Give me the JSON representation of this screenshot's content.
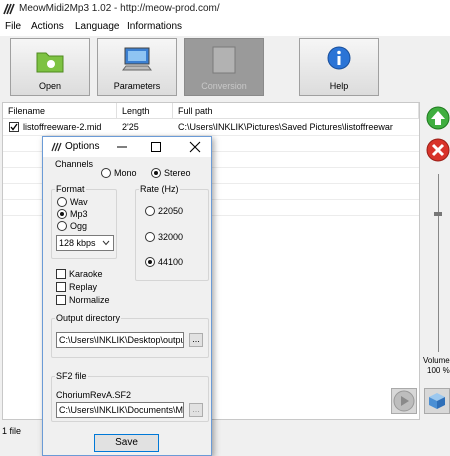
{
  "window": {
    "title": "MeowMidi2Mp3 1.02 - http://meow-prod.com/"
  },
  "menu": [
    "File",
    "Actions",
    "Language",
    "Informations"
  ],
  "toolbar": {
    "open": "Open",
    "parameters": "Parameters",
    "conversion": "Conversion",
    "help": "Help"
  },
  "filelist": {
    "columns": [
      "Filename",
      "Length",
      "Full path"
    ],
    "rows": [
      {
        "filename": "listoffreeware-2.mid",
        "length": "2'25",
        "path": "C:\\Users\\INKLIK\\Pictures\\Saved Pictures\\listoffreewar",
        "checked": true
      }
    ]
  },
  "side": {
    "volume_label": "Volume",
    "volume_value": "100 %",
    "volume_level": 1.0
  },
  "status": {
    "count": "1 file"
  },
  "dialog": {
    "title": "Options",
    "channels": {
      "label": "Channels",
      "mono": "Mono",
      "stereo": "Stereo",
      "selected": "Stereo"
    },
    "format": {
      "label": "Format",
      "wav": "Wav",
      "mp3": "Mp3",
      "ogg": "Ogg",
      "selected": "Mp3",
      "bitrate": "128 kbps"
    },
    "rate": {
      "label": "Rate (Hz)",
      "r1": "22050",
      "r2": "32000",
      "r3": "44100",
      "selected": "44100"
    },
    "options": {
      "karaoke": "Karaoke",
      "replay": "Replay",
      "normalize": "Normalize"
    },
    "output": {
      "label": "Output directory",
      "value": "C:\\Users\\INKLIK\\Desktop\\outpu",
      "browse": "..."
    },
    "sf2": {
      "label": "SF2 file",
      "name": "ChoriumRevA.SF2",
      "value": "C:\\Users\\INKLIK\\Documents\\M",
      "browse": "..."
    },
    "save": "Save"
  }
}
